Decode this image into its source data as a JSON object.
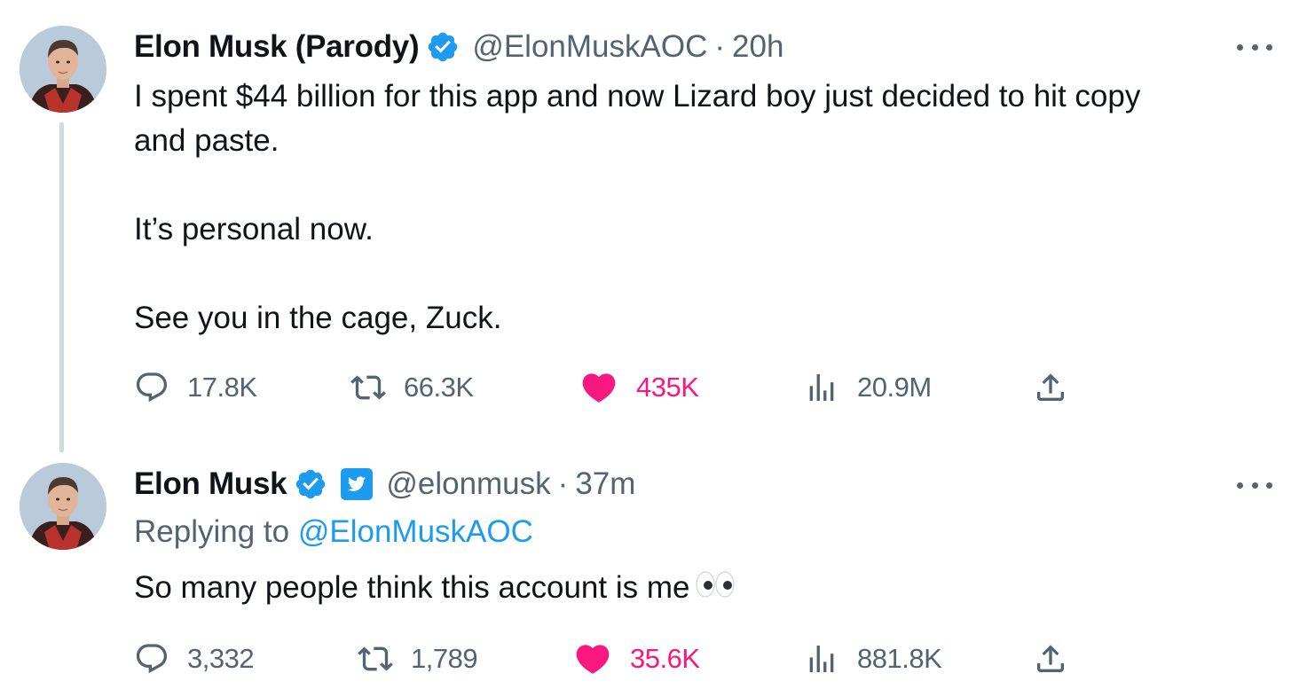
{
  "tweets": [
    {
      "name": "Elon Musk (Parody)",
      "handle": "@ElonMuskAOC",
      "separator": "·",
      "time": "20h",
      "text": "I spent $44 billion for this app and now Lizard boy just decided to hit copy\nand paste.\n\nIt’s personal now.\n\nSee you in the cage, Zuck.",
      "stats": {
        "replies": "17.8K",
        "retweets": "66.3K",
        "likes": "435K",
        "views": "20.9M"
      },
      "icons": [
        "verified-badge-icon",
        "reply-icon",
        "retweet-icon",
        "heart-icon",
        "views-icon",
        "share-icon",
        "more-icon"
      ]
    },
    {
      "name": "Elon Musk",
      "handle": "@elonmusk",
      "separator": "·",
      "time": "37m",
      "replying_prefix": "Replying to ",
      "replying_to": "@ElonMuskAOC",
      "text": "So many people think this account is me",
      "emoji": "eyes-emoji",
      "stats": {
        "replies": "3,332",
        "retweets": "1,789",
        "likes": "35.6K",
        "views": "881.8K"
      },
      "icons": [
        "verified-badge-icon",
        "twitter-affiliate-badge-icon",
        "reply-icon",
        "retweet-icon",
        "heart-icon",
        "views-icon",
        "share-icon",
        "more-icon"
      ]
    }
  ],
  "colors": {
    "text": "#0f1419",
    "secondary": "#536471",
    "accent": "#1d9bf0",
    "like": "#f91880",
    "thread_line": "#cfd9de"
  }
}
